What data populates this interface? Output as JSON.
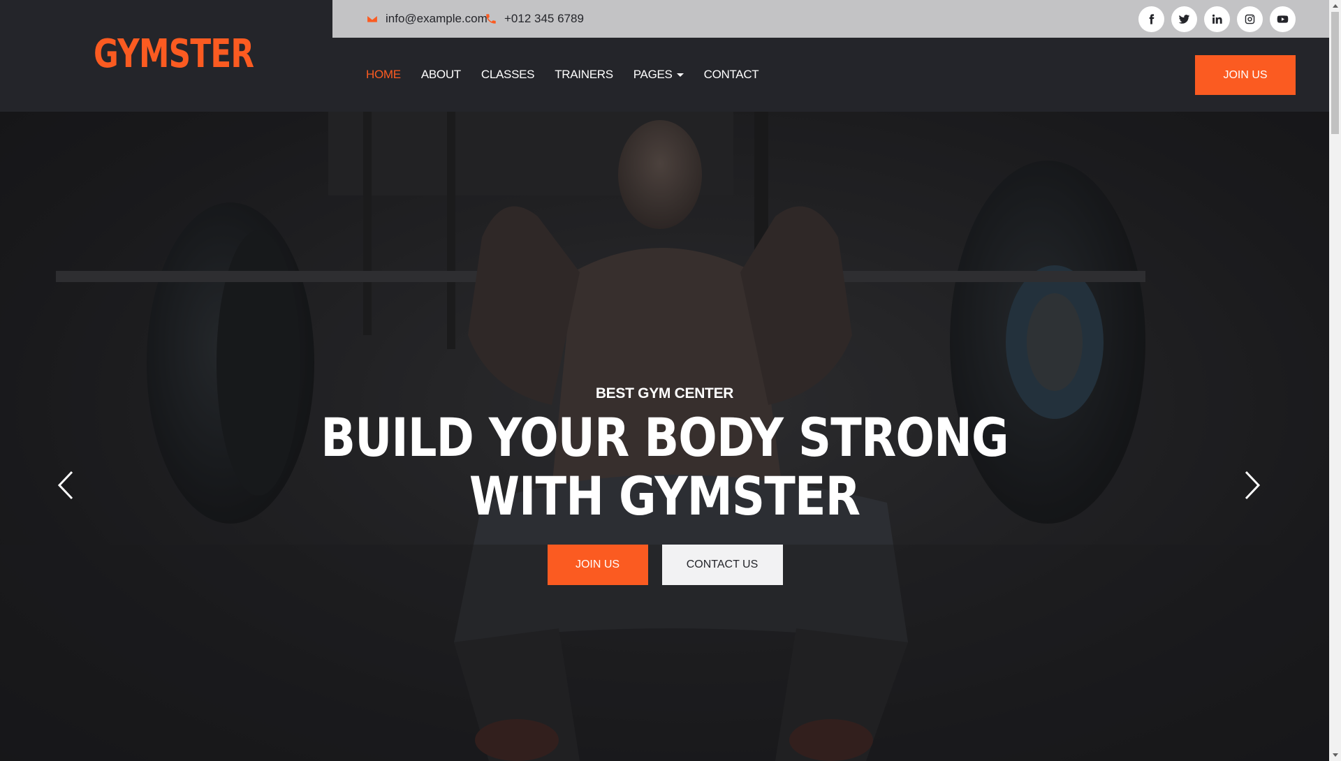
{
  "brand": {
    "name": "GYMSTER"
  },
  "topbar": {
    "email": "info@example.com",
    "phone": "+012 345 6789",
    "email_icon": "envelope-icon",
    "phone_icon": "phone-icon",
    "social": [
      "facebook-icon",
      "twitter-icon",
      "linkedin-icon",
      "instagram-icon",
      "youtube-icon"
    ]
  },
  "nav": {
    "items": [
      {
        "label": "HOME",
        "active": true
      },
      {
        "label": "ABOUT"
      },
      {
        "label": "CLASSES"
      },
      {
        "label": "TRAINERS"
      },
      {
        "label": "PAGES",
        "dropdown": true
      },
      {
        "label": "CONTACT"
      }
    ],
    "join_label": "JOIN US"
  },
  "hero": {
    "subtitle": "BEST GYM CENTER",
    "title_line1": "BUILD YOUR BODY STRONG",
    "title_line2": "WITH GYMSTER",
    "primary_button": "JOIN US",
    "secondary_button": "CONTACT US"
  },
  "colors": {
    "accent": "#fb5b21",
    "dark": "#24252a",
    "topbar": "#c3c3c5"
  }
}
